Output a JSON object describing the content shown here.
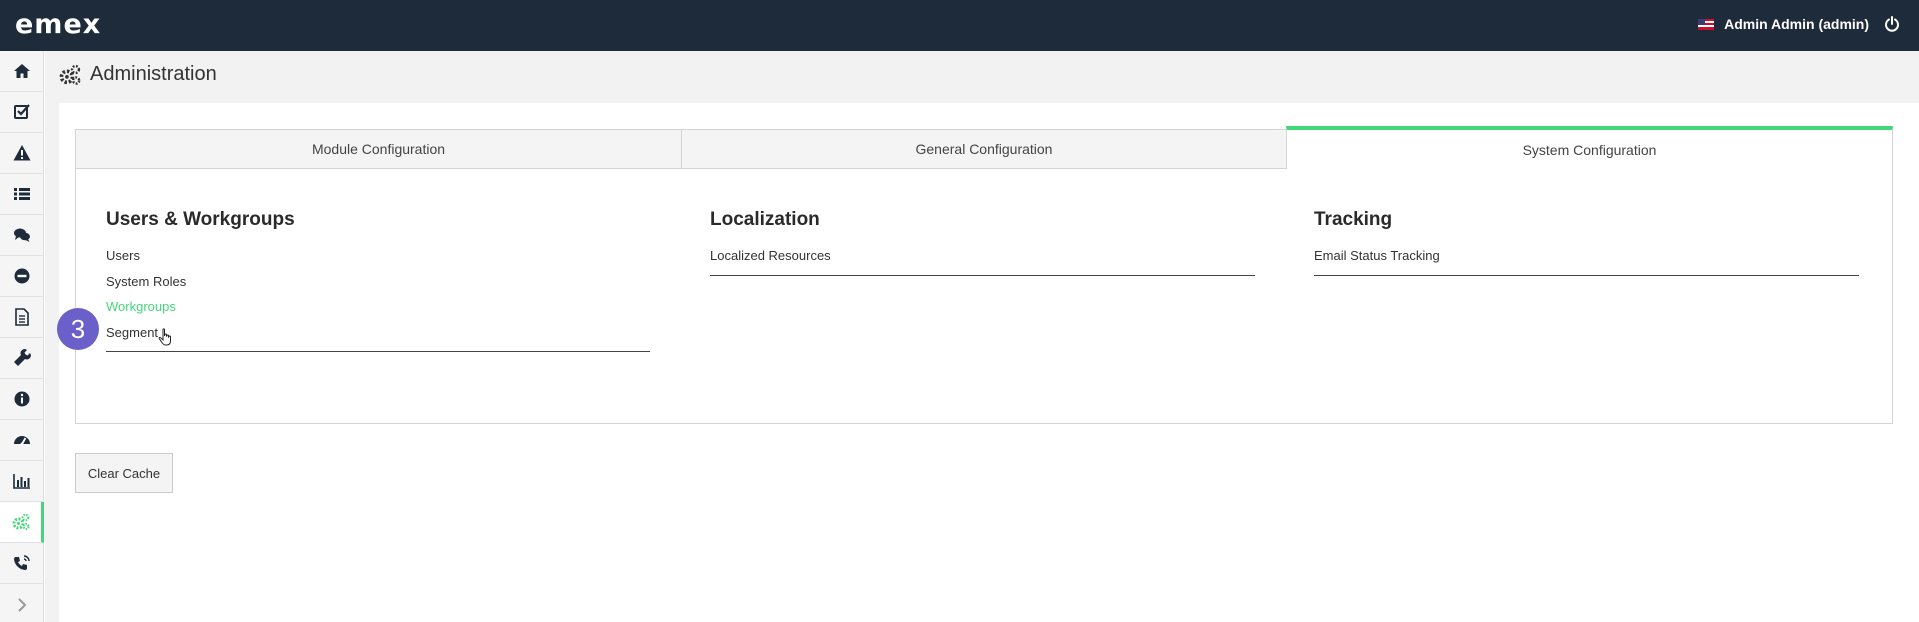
{
  "app": {
    "logo": "emex"
  },
  "user": {
    "name": "Admin Admin (admin)",
    "flag_icon": "uk-flag-icon"
  },
  "sidebar": {
    "items": [
      {
        "name": "home",
        "icon": "home-icon"
      },
      {
        "name": "tasks",
        "icon": "checkbox-icon"
      },
      {
        "name": "incidents",
        "icon": "warning-icon"
      },
      {
        "name": "lists",
        "icon": "list-icon"
      },
      {
        "name": "messages",
        "icon": "comments-icon"
      },
      {
        "name": "blocked",
        "icon": "minus-circle-icon"
      },
      {
        "name": "documents",
        "icon": "document-icon"
      },
      {
        "name": "tools",
        "icon": "wrench-icon"
      },
      {
        "name": "info",
        "icon": "info-icon"
      },
      {
        "name": "dashboard",
        "icon": "speedometer-icon"
      },
      {
        "name": "reports",
        "icon": "bar-chart-icon"
      },
      {
        "name": "administration",
        "icon": "gears-icon",
        "active": true
      },
      {
        "name": "calls",
        "icon": "phone-volume-icon"
      },
      {
        "name": "expand",
        "icon": "chevron-right-icon"
      }
    ]
  },
  "page": {
    "title": "Administration"
  },
  "tabs": [
    {
      "label": "Module Configuration"
    },
    {
      "label": "General Configuration"
    },
    {
      "label": "System Configuration",
      "active": true
    }
  ],
  "sections": {
    "users": {
      "title": "Users & Workgroups",
      "links": [
        "Users",
        "System Roles",
        "Workgroups",
        "Segment"
      ]
    },
    "localization": {
      "title": "Localization",
      "links": [
        "Localized Resources"
      ]
    },
    "tracking": {
      "title": "Tracking",
      "links": [
        "Email Status Tracking"
      ]
    }
  },
  "step_badge": "3",
  "buttons": {
    "clear_cache": "Clear Cache"
  },
  "colors": {
    "topbar": "#1e2b3b",
    "accent": "#44d77a",
    "badge": "#6b5fc9"
  }
}
